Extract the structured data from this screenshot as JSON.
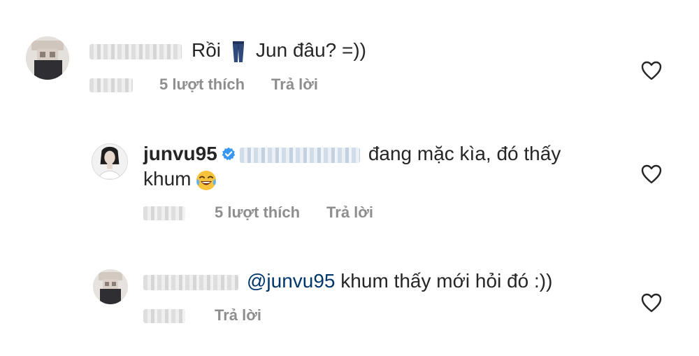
{
  "comments": [
    {
      "text_before": "Rồi",
      "text_after": "Jun đâu? =))",
      "emoji": "jeans-emoji",
      "likes_label": "5 lượt thích",
      "reply_label": "Trả lời"
    },
    {
      "username": "junvu95",
      "verified": true,
      "text_line1": "đang mặc kìa, đó thấy",
      "text_line2": "khum",
      "emoji": "tears-of-joy-emoji",
      "likes_label": "5 lượt thích",
      "reply_label": "Trả lời"
    },
    {
      "mention": "@junvu95",
      "text": "khum thấy mới hỏi đó :))",
      "reply_label": "Trả lời"
    }
  ],
  "colors": {
    "text": "#262626",
    "meta": "#8e8e8e",
    "mention": "#00376b",
    "verified": "#3897f0"
  }
}
